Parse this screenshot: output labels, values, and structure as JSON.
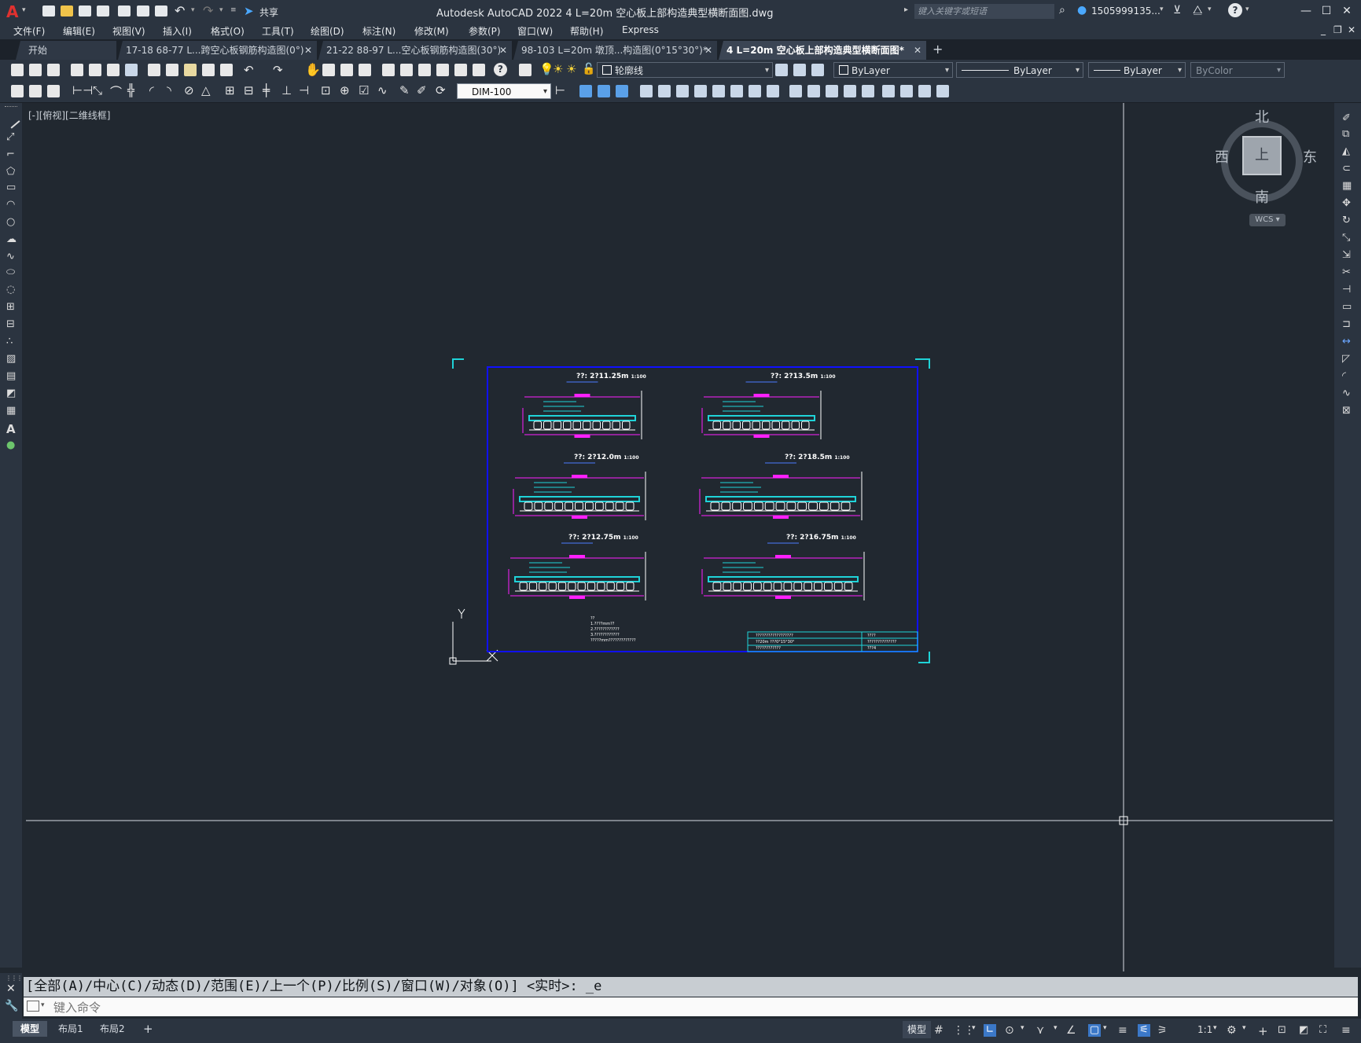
{
  "app": {
    "title": "Autodesk AutoCAD 2022    4 L=20m 空心板上部构造典型横断面图.dwg",
    "search_placeholder": "键入关键字或短语",
    "user": "1505999135...",
    "share_label": "共享"
  },
  "menu": [
    "文件(F)",
    "编辑(E)",
    "视图(V)",
    "插入(I)",
    "格式(O)",
    "工具(T)",
    "绘图(D)",
    "标注(N)",
    "修改(M)",
    "参数(P)",
    "窗口(W)",
    "帮助(H)",
    "Express"
  ],
  "tabs": [
    {
      "label": "开始",
      "active": false
    },
    {
      "label": "17-18 68-77 L...跨空心板钢筋构造图(0°)",
      "active": false
    },
    {
      "label": "21-22 88-97 L...空心板钢筋构造图(30°)",
      "active": false
    },
    {
      "label": "98-103 L=20m 墩顶...构造图(0°15°30°)*",
      "active": false
    },
    {
      "label": "4 L=20m 空心板上部构造典型横断面图*",
      "active": true
    }
  ],
  "toolbar": {
    "layer": "轮廓线",
    "color": "ByLayer",
    "linetype": "ByLayer",
    "lineweight": "ByLayer",
    "plotstyle": "ByColor",
    "dimstyle": "DIM-100"
  },
  "viewport_label": "[-][俯视][二维线框]",
  "viewcube": {
    "north": "北",
    "south": "南",
    "east": "东",
    "west": "西",
    "top": "上",
    "wcs": "WCS"
  },
  "ucs": {
    "x": "X",
    "y": "Y"
  },
  "drawing": {
    "sections": [
      {
        "title": "??: 2?11.25m",
        "scale": "1:100"
      },
      {
        "title": "??: 2?13.5m",
        "scale": "1:100"
      },
      {
        "title": "??: 2?12.0m",
        "scale": "1:100"
      },
      {
        "title": "??: 2?18.5m",
        "scale": "1:100"
      },
      {
        "title": "??: 2?12.75m",
        "scale": "1:100"
      },
      {
        "title": "??: 2?16.75m",
        "scale": "1:100"
      }
    ],
    "notes": [
      "??",
      "1.????mm??",
      "2.????????????",
      "3.????????????",
      "  ?????mm?????????????"
    ],
    "titleblock": [
      "??????????????????",
      "??20m     ???0°15°30°",
      "????????????",
      "????",
      "??????????????",
      "???4"
    ]
  },
  "command": {
    "history": "[全部(A)/中心(C)/动态(D)/范围(E)/上一个(P)/比例(S)/窗口(W)/对象(O)] <实时>: _e",
    "placeholder": "键入命令"
  },
  "status": {
    "layout_tabs": [
      "模型",
      "布局1",
      "布局2"
    ],
    "model_label": "模型",
    "scale": "1:1"
  },
  "colors": {
    "accent": "#1fd3d8",
    "magenta": "#ff20ff",
    "frame": "#1010ff",
    "background": "#212830"
  }
}
